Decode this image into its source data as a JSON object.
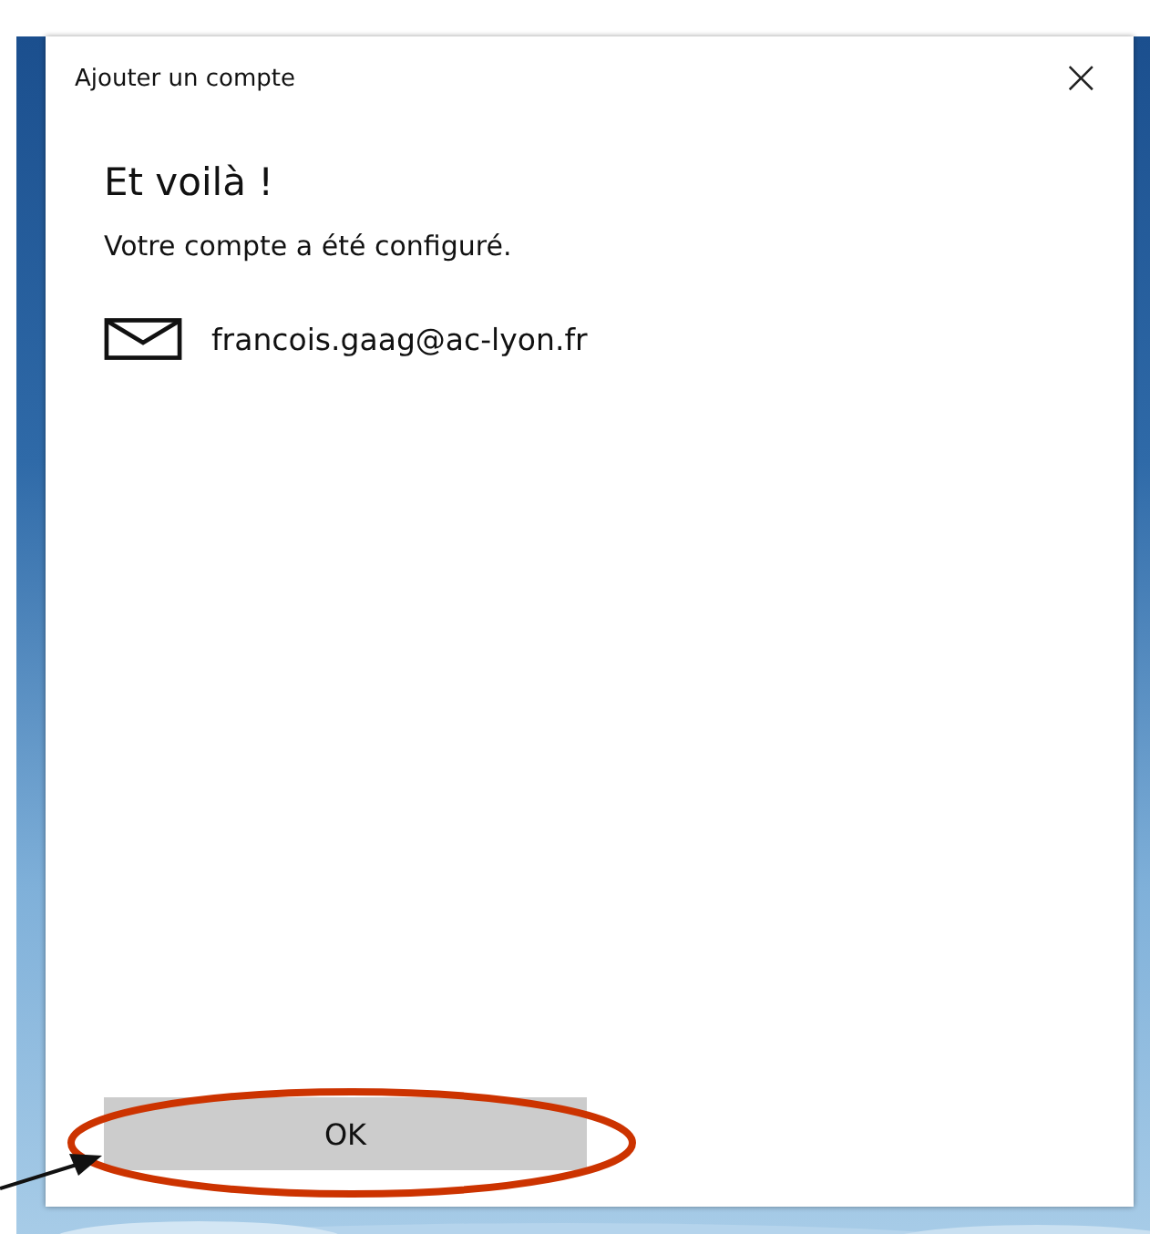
{
  "window": {
    "title": "Ajouter un compte",
    "close": "×"
  },
  "heading": "Et voilà !",
  "message": "Votre compte a été configuré.",
  "account": {
    "email": "francois.gaag@ac-lyon.fr"
  },
  "buttons": [
    {
      "label": "OK"
    }
  ]
}
